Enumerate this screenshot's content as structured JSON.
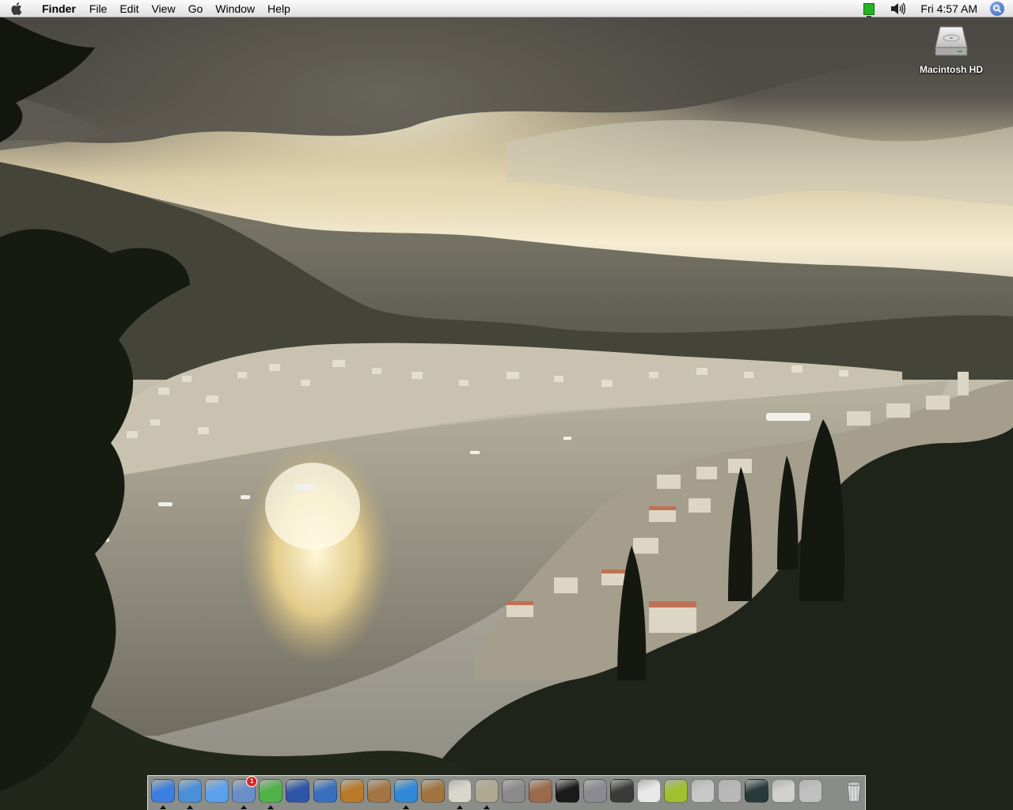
{
  "menubar": {
    "apple_icon": "apple-logo-icon",
    "app_name": "Finder",
    "menus": [
      "File",
      "Edit",
      "View",
      "Go",
      "Window",
      "Help"
    ],
    "battery_icon": "battery-icon",
    "volume_icon": "speaker-volume-icon",
    "clock": "Fri 4:57 AM",
    "spotlight_icon": "spotlight-search-icon"
  },
  "desktop": {
    "icons": [
      {
        "label": "Macintosh HD",
        "icon": "hard-drive-icon"
      }
    ]
  },
  "dock": {
    "apps": [
      {
        "icon": "finder-icon",
        "running": true,
        "color": "#3d7fe0"
      },
      {
        "icon": "safari-icon",
        "running": true,
        "color": "#4a90d8"
      },
      {
        "icon": "ichat-icon",
        "running": false,
        "color": "#5aa2ee"
      },
      {
        "icon": "mail-icon",
        "running": true,
        "badge": "1",
        "color": "#6a8fc8"
      },
      {
        "icon": "itunes-icon",
        "running": true,
        "color": "#4fb34a"
      },
      {
        "icon": "imovie-icon",
        "running": false,
        "color": "#2e55a8"
      },
      {
        "icon": "idvd-icon",
        "running": false,
        "color": "#3a6fc0"
      },
      {
        "icon": "garageband-icon",
        "running": false,
        "color": "#b87a2a"
      },
      {
        "icon": "iphoto-icon",
        "running": false,
        "color": "#a47544"
      },
      {
        "icon": "quicktime-icon",
        "running": true,
        "color": "#2f88d8"
      },
      {
        "icon": "address-book-icon",
        "running": false,
        "color": "#a1743e"
      },
      {
        "icon": "textedit-icon",
        "running": true,
        "color": "#d9d6cc"
      },
      {
        "icon": "preview-icon",
        "running": true,
        "color": "#b0a890"
      },
      {
        "icon": "image-capture-icon",
        "running": false,
        "color": "#8a8a8a"
      },
      {
        "icon": "keychain-access-icon",
        "running": false,
        "color": "#9a6a4a"
      },
      {
        "icon": "terminal-icon",
        "running": false,
        "color": "#1a1a1a"
      },
      {
        "icon": "automator-icon",
        "running": false,
        "color": "#8a8a90"
      },
      {
        "icon": "clapboard-icon",
        "running": false,
        "color": "#3a3a3a"
      },
      {
        "icon": "ipod-updater-icon",
        "running": false,
        "color": "#e8e8e8"
      },
      {
        "icon": "hair-dryer-icon",
        "running": false,
        "color": "#a0c030"
      },
      {
        "icon": "system-profiler-icon",
        "running": false,
        "color": "#c8c8c8"
      },
      {
        "icon": "printer-setup-icon",
        "running": false,
        "color": "#b8b8b8"
      },
      {
        "icon": "activity-monitor-icon",
        "running": false,
        "color": "#2a3a3a"
      },
      {
        "icon": "about-this-mac-icon",
        "running": false,
        "color": "#d0d0d0"
      },
      {
        "icon": "disk-utility-icon",
        "running": false,
        "color": "#c0c0c0"
      }
    ],
    "trash_icon": "trash-icon"
  },
  "colors": {
    "menubar_top": "#fbfbfb",
    "menubar_bottom": "#dedede",
    "sky_light": "#f4e6c0",
    "water": "#d8c8a0",
    "foliage": "#1e2418"
  }
}
